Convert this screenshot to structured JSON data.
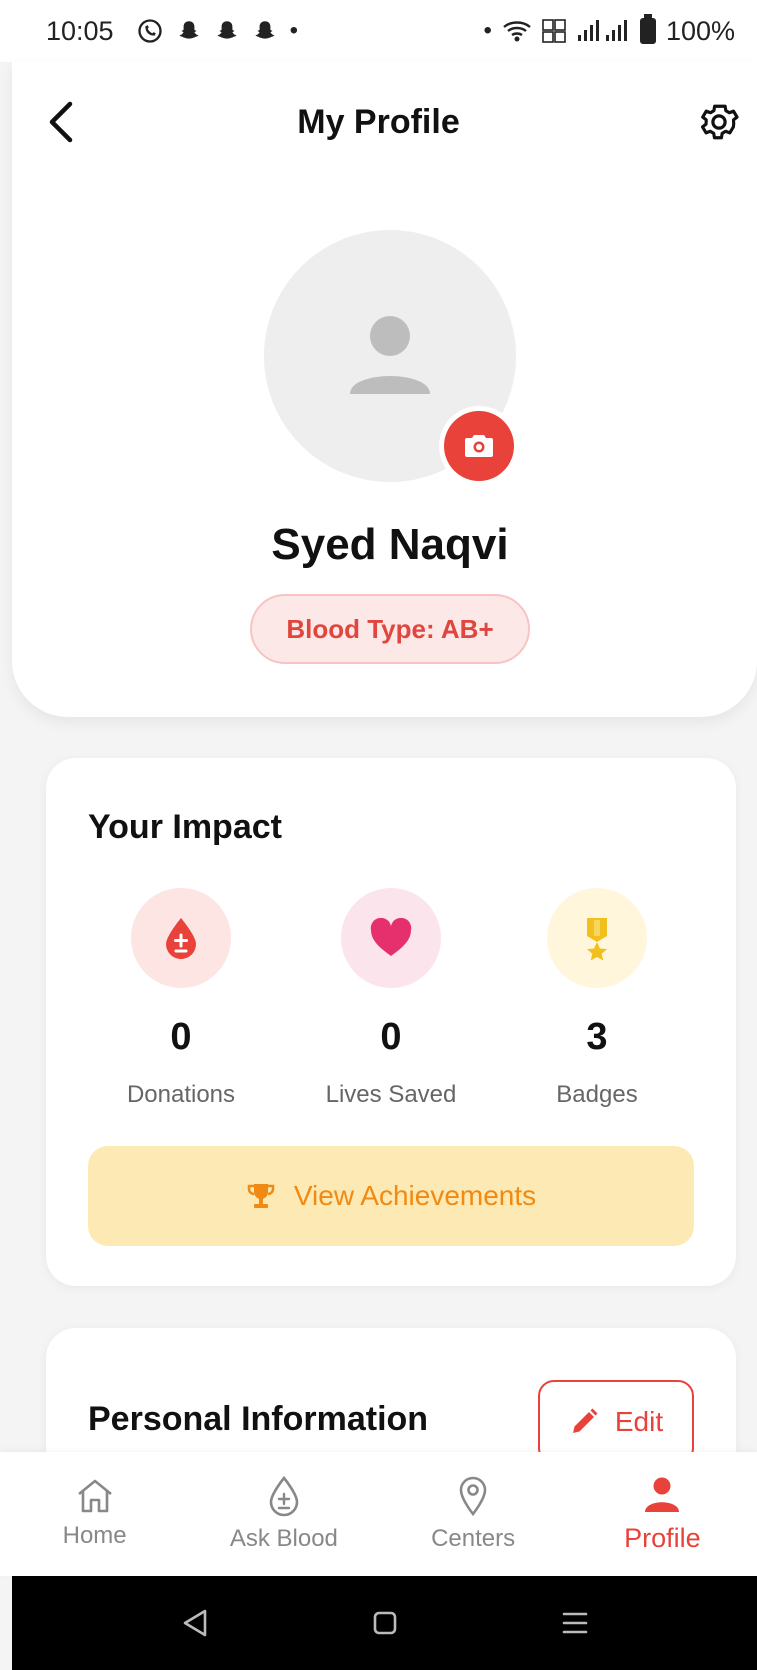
{
  "status_bar": {
    "time": "10:05",
    "battery": "100%"
  },
  "app_bar": {
    "title": "My Profile"
  },
  "profile": {
    "name": "Syed Naqvi",
    "blood_type_label": "Blood Type: AB+"
  },
  "impact": {
    "title": "Your Impact",
    "stats": [
      {
        "value": "0",
        "label": "Donations",
        "icon": "blood-drop-icon",
        "color": "#e8423a",
        "bg": "#fde5e3"
      },
      {
        "value": "0",
        "label": "Lives Saved",
        "icon": "heart-icon",
        "color": "#e6306e",
        "bg": "#fce4ec"
      },
      {
        "value": "3",
        "label": "Badges",
        "icon": "medal-icon",
        "color": "#f2c01c",
        "bg": "#fff6dc"
      }
    ],
    "achievements_label": "View Achievements"
  },
  "personal": {
    "title": "Personal Information",
    "edit_label": "Edit"
  },
  "bottom_nav": {
    "items": [
      {
        "label": "Home",
        "icon": "home-icon"
      },
      {
        "label": "Ask Blood",
        "icon": "blood-drop-icon"
      },
      {
        "label": "Centers",
        "icon": "location-pin-icon"
      },
      {
        "label": "Profile",
        "icon": "person-icon"
      }
    ],
    "active": "Profile"
  },
  "colors": {
    "accent": "#e8423a",
    "achievement_bg": "#fde9b3",
    "achievement_text": "#f08a13"
  }
}
